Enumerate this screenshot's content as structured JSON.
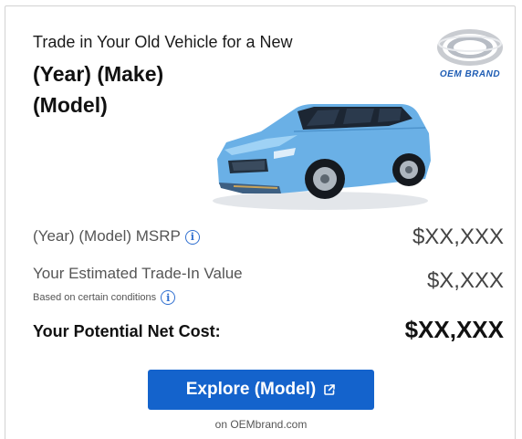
{
  "header": {
    "subtitle": "Trade in Your Old Vehicle for a New",
    "title": "(Year) (Make) (Model)"
  },
  "brand": {
    "logo_text": "OEM BRAND",
    "color": "#1f5db4"
  },
  "vehicle": {
    "image_icon": "car-image",
    "body_color": "#6ab0e6"
  },
  "pricing": {
    "msrp_label": "(Year) (Model) MSRP",
    "msrp_value": "$XX,XXX",
    "trade_label": "Your Estimated Trade-In Value",
    "trade_note": "Based on certain conditions",
    "trade_value": "$X,XXX",
    "net_label": "Your Potential Net Cost:",
    "net_value": "$XX,XXX"
  },
  "cta": {
    "label": "Explore (Model)",
    "icon": "external-link-icon",
    "color": "#1463cc"
  },
  "footer": {
    "domain": "on OEMbrand.com"
  }
}
